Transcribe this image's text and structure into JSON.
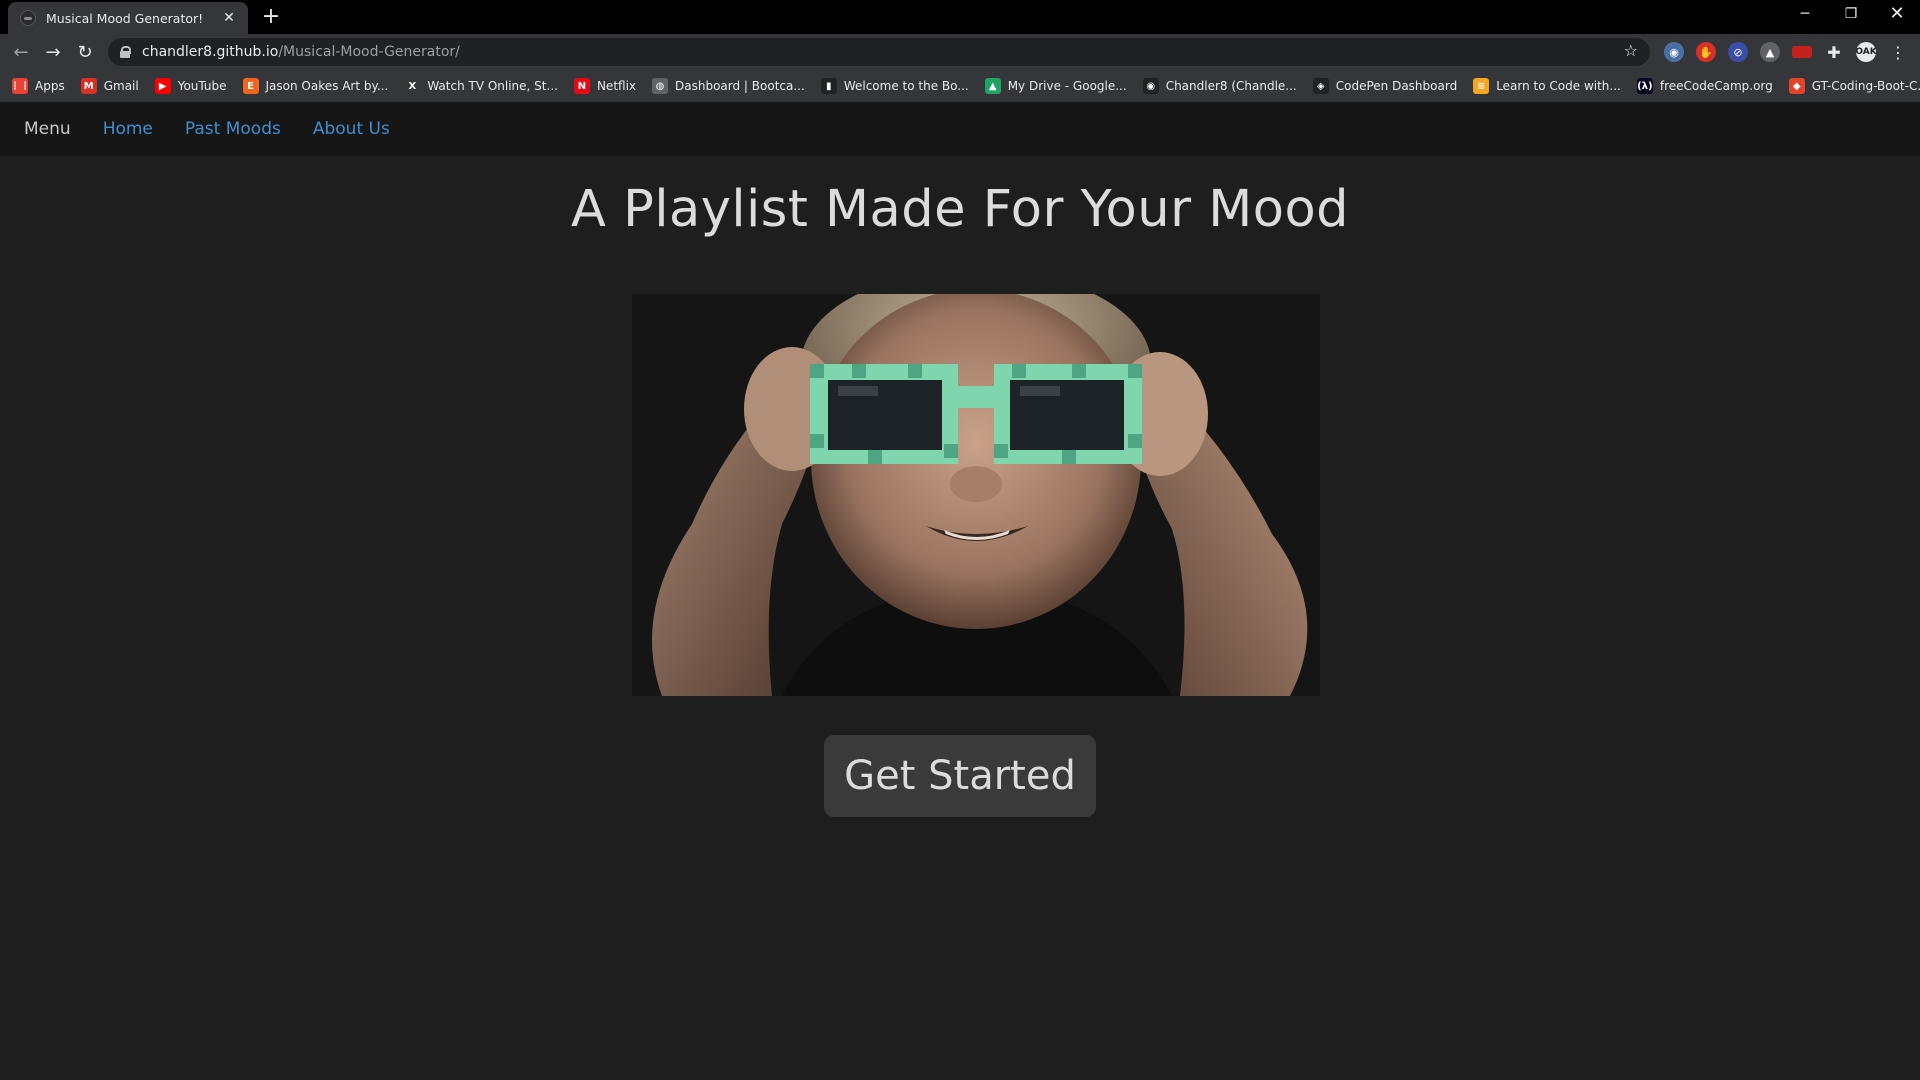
{
  "browser": {
    "tab_title": "Musical Mood Generator!",
    "url_host": "chandler8.github.io",
    "url_path": "/Musical-Mood-Generator/",
    "bookmarks": [
      {
        "label": "Apps",
        "icon": "apps-grid-icon",
        "color": "#ea4335"
      },
      {
        "label": "Gmail",
        "icon": "gmail-icon",
        "color": "#d93025"
      },
      {
        "label": "YouTube",
        "icon": "youtube-icon",
        "color": "#ff0000"
      },
      {
        "label": "Jason Oakes Art by...",
        "icon": "etsy-icon",
        "color": "#f1641e"
      },
      {
        "label": "Watch TV Online, St...",
        "icon": "x-icon",
        "color": "#35363a"
      },
      {
        "label": "Netflix",
        "icon": "netflix-icon",
        "color": "#e50914"
      },
      {
        "label": "Dashboard | Bootca...",
        "icon": "globe-icon",
        "color": "#5f6368"
      },
      {
        "label": "Welcome to the Bo...",
        "icon": "book-icon",
        "color": "#202124"
      },
      {
        "label": "My Drive - Google...",
        "icon": "google-drive-icon",
        "color": "#1fa463"
      },
      {
        "label": "Chandler8 (Chandle...",
        "icon": "github-icon",
        "color": "#202124"
      },
      {
        "label": "CodePen Dashboard",
        "icon": "codepen-icon",
        "color": "#202124"
      },
      {
        "label": "Learn to Code with...",
        "icon": "codecademy-icon",
        "color": "#f5a623"
      },
      {
        "label": "freeCodeCamp.org",
        "icon": "freecodecamp-icon",
        "color": "#0a0a23"
      },
      {
        "label": "GT-Coding-Boot-C...",
        "icon": "gitlab-icon",
        "color": "#e24329"
      }
    ]
  },
  "site_nav": {
    "menu_label": "Menu",
    "links": [
      "Home",
      "Past Moods",
      "About Us"
    ],
    "link_color": "#3e8ed0"
  },
  "main": {
    "headline": "A Playlist Made For Your Mood",
    "hero_image": "toddler-wearing-pixel-sunglasses",
    "cta_label": "Get Started"
  }
}
